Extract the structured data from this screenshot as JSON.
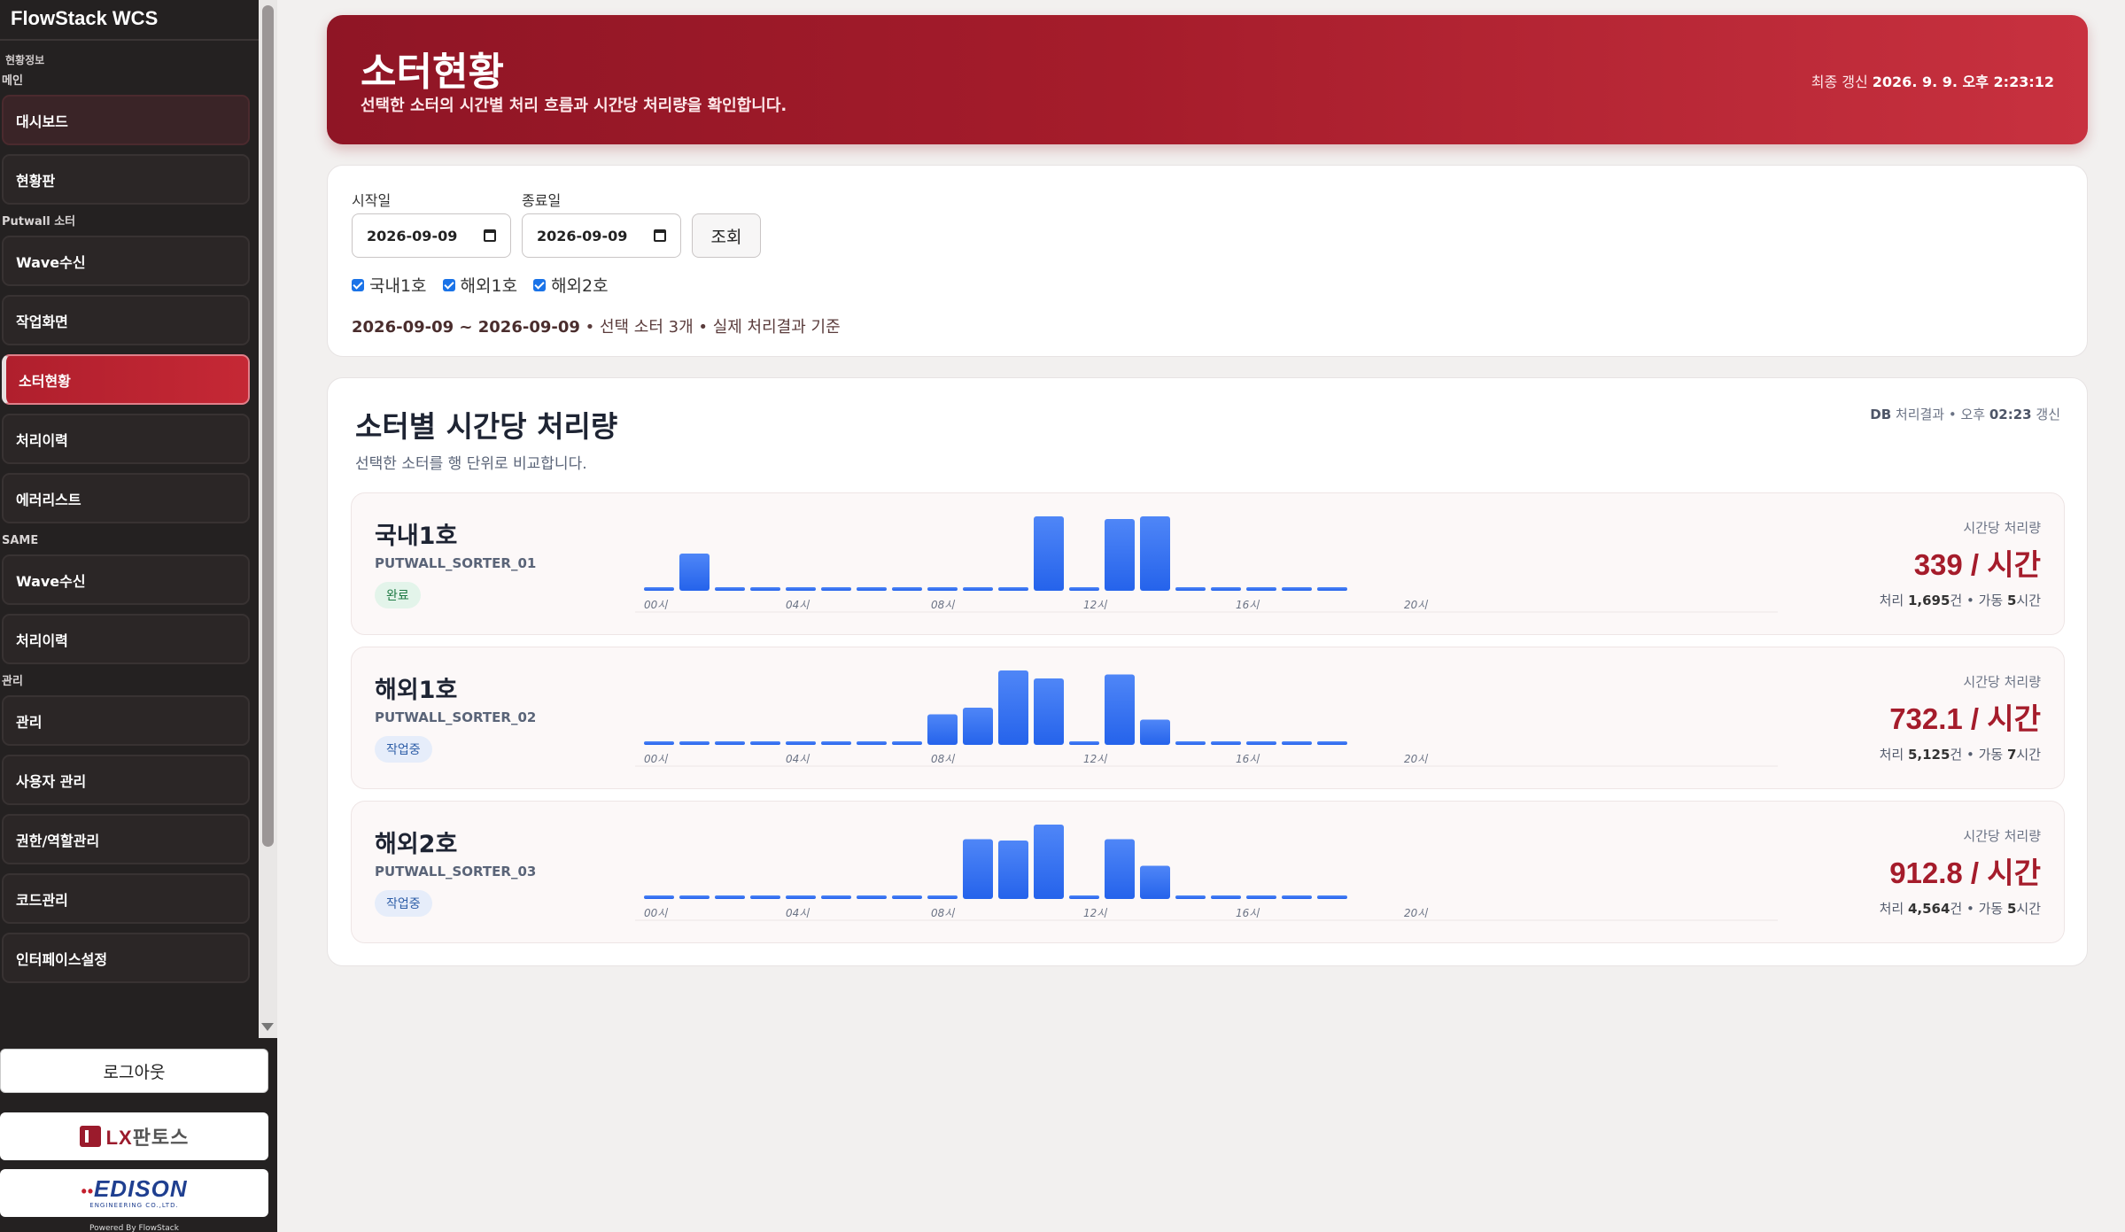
{
  "app": {
    "brand": "FlowStack WCS"
  },
  "sidebar": {
    "sections": [
      {
        "label": "현황정보",
        "small": true,
        "items": []
      },
      {
        "label": "메인",
        "items": [
          "대시보드",
          "현황판"
        ]
      },
      {
        "label": "Putwall 소터",
        "items": [
          "Wave수신",
          "작업화면",
          "소터현황",
          "처리이력",
          "에러리스트"
        ]
      },
      {
        "label": "SAME",
        "items": [
          "Wave수신",
          "처리이력"
        ]
      },
      {
        "label": "관리",
        "items": [
          "관리",
          "사용자 관리",
          "권한/역할관리",
          "코드관리",
          "인터페이스설정"
        ]
      }
    ],
    "active_item": "소터현황",
    "logout_label": "로그아웃",
    "logo_lx": "LX판토스",
    "logo_edison": "EDISON",
    "logo_edison_sub": "ENGINEERING CO.,LTD.",
    "powered": "Powered By FlowStack"
  },
  "hero": {
    "title": "소터현황",
    "description": "선택한 소터의 시간별 처리 흐름과 시간당 처리량을 확인합니다.",
    "updated_label": "최종 갱신",
    "updated_value": "2026. 9. 9. 오후 2:23:12"
  },
  "filter": {
    "start_label": "시작일",
    "end_label": "종료일",
    "start_value": "2026-09-09",
    "end_value": "2026-09-09",
    "search_label": "조회",
    "checks": [
      "국내1호",
      "해외1호",
      "해외2호"
    ],
    "range_dates": "2026-09-09 ~ 2026-09-09",
    "range_tail": " • 선택 소터 3개 • 실제 처리결과 기준"
  },
  "chart_section": {
    "title": "소터별 시간당 처리량",
    "subtitle": "선택한 소터를 행 단위로 비교합니다.",
    "meta_db": "DB",
    "meta_rest": " 처리결과 • 오후 ",
    "meta_time": "02:23",
    "meta_end": " 갱신"
  },
  "chart_data": [
    {
      "type": "bar",
      "title": "국내1호",
      "code": "PUTWALL_SORTER_01",
      "status": "완료",
      "x_ticks": [
        "00시",
        "04시",
        "08시",
        "12시",
        "16시",
        "20시"
      ],
      "categories": [
        0,
        1,
        2,
        3,
        4,
        5,
        6,
        7,
        8,
        9,
        10,
        11,
        12,
        13,
        14,
        15,
        16,
        17,
        18,
        19,
        20,
        21,
        22,
        23
      ],
      "values": [
        0,
        28,
        0,
        0,
        0,
        0,
        0,
        0,
        0,
        0,
        0,
        56,
        0,
        54,
        56,
        0,
        0,
        0,
        0,
        0,
        0,
        0,
        0,
        0
      ],
      "ylim": [
        0,
        60
      ],
      "rate_label": "시간당 처리량",
      "rate_value": "339 / 시간",
      "total_prefix": "처리 ",
      "total_count": "1,695",
      "total_mid": "건 • 가동 ",
      "run_hours": "5",
      "total_suffix": "시간"
    },
    {
      "type": "bar",
      "title": "해외1호",
      "code": "PUTWALL_SORTER_02",
      "status": "작업중",
      "x_ticks": [
        "00시",
        "04시",
        "08시",
        "12시",
        "16시",
        "20시"
      ],
      "categories": [
        0,
        1,
        2,
        3,
        4,
        5,
        6,
        7,
        8,
        9,
        10,
        11,
        12,
        13,
        14,
        15,
        16,
        17,
        18,
        19,
        20,
        21,
        22,
        23
      ],
      "values": [
        0,
        0,
        0,
        0,
        0,
        0,
        0,
        0,
        23,
        28,
        56,
        50,
        0,
        53,
        19,
        0,
        0,
        0,
        0,
        0,
        0,
        0,
        0,
        0
      ],
      "ylim": [
        0,
        60
      ],
      "rate_label": "시간당 처리량",
      "rate_value": "732.1 / 시간",
      "total_prefix": "처리 ",
      "total_count": "5,125",
      "total_mid": "건 • 가동 ",
      "run_hours": "7",
      "total_suffix": "시간"
    },
    {
      "type": "bar",
      "title": "해외2호",
      "code": "PUTWALL_SORTER_03",
      "status": "작업중",
      "x_ticks": [
        "00시",
        "04시",
        "08시",
        "12시",
        "16시",
        "20시"
      ],
      "categories": [
        0,
        1,
        2,
        3,
        4,
        5,
        6,
        7,
        8,
        9,
        10,
        11,
        12,
        13,
        14,
        15,
        16,
        17,
        18,
        19,
        20,
        21,
        22,
        23
      ],
      "values": [
        0,
        0,
        0,
        0,
        0,
        0,
        0,
        0,
        0,
        45,
        44,
        56,
        0,
        45,
        25,
        0,
        0,
        0,
        0,
        0,
        0,
        0,
        0,
        0
      ],
      "ylim": [
        0,
        60
      ],
      "rate_label": "시간당 처리량",
      "rate_value": "912.8 / 시간",
      "total_prefix": "처리 ",
      "total_count": "4,564",
      "total_mid": "건 • 가동 ",
      "run_hours": "5",
      "total_suffix": "시간"
    }
  ],
  "colors": {
    "accent": "#a51c2b",
    "bar_top": "#4f86f7",
    "bar_bottom": "#2563eb",
    "sidebar_bg": "#242121"
  }
}
